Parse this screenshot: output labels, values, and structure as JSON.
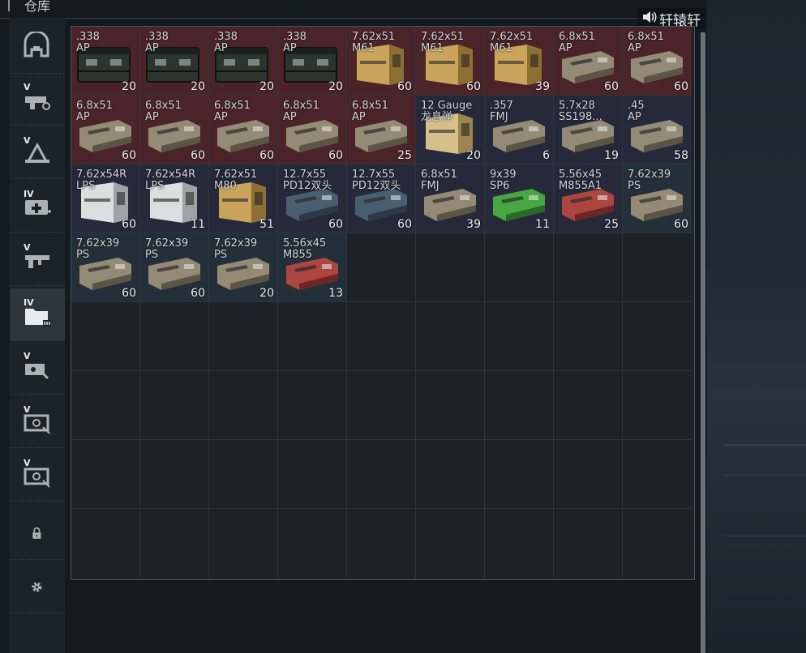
{
  "header": {
    "title": "仓库"
  },
  "sound": {
    "icon": "speaker-icon",
    "label": "轩辕轩"
  },
  "sidebar": {
    "items": [
      {
        "name": "vault-icon",
        "tier": ""
      },
      {
        "name": "tier5-weapon-icon",
        "tier": "V"
      },
      {
        "name": "tier5-armor-icon",
        "tier": "V"
      },
      {
        "name": "tier4-medical-icon",
        "tier": "IV"
      },
      {
        "name": "tier5-gun-icon",
        "tier": "V"
      },
      {
        "name": "tier4-folder-icon",
        "tier": "IV"
      },
      {
        "name": "tier5-gear-icon",
        "tier": "V"
      },
      {
        "name": "tier5-case-icon",
        "tier": "V"
      },
      {
        "name": "tier5-case2-icon",
        "tier": "V"
      },
      {
        "name": "lock-icon",
        "tier": ""
      },
      {
        "name": "gear-icon",
        "tier": ""
      }
    ]
  },
  "colors": {
    "red_cell": "#4b2429",
    "blue_cell": "#25293a",
    "steel_cell": "#233039",
    "box_green": "#2c3430",
    "box_tan": "#bf9a52",
    "box_white": "#d9dcdd",
    "box_steel": "#42566a",
    "box_khaki": "#8c826e",
    "box_green_bright": "#3f9c3b",
    "box_red": "#a7403c"
  },
  "items": [
    {
      "caliber": ".338",
      "type": "AP",
      "qty": "20",
      "bg": "red",
      "box": "crate"
    },
    {
      "caliber": ".338",
      "type": "AP",
      "qty": "20",
      "bg": "red",
      "box": "crate"
    },
    {
      "caliber": ".338",
      "type": "AP",
      "qty": "20",
      "bg": "red",
      "box": "crate"
    },
    {
      "caliber": ".338",
      "type": "AP",
      "qty": "20",
      "bg": "red",
      "box": "crate"
    },
    {
      "caliber": "7.62x51",
      "type": "M61",
      "qty": "60",
      "bg": "red",
      "box": "tan"
    },
    {
      "caliber": "7.62x51",
      "type": "M61",
      "qty": "60",
      "bg": "red",
      "box": "tan"
    },
    {
      "caliber": "7.62x51",
      "type": "M61",
      "qty": "39",
      "bg": "red",
      "box": "tan"
    },
    {
      "caliber": "6.8x51",
      "type": "AP",
      "qty": "60",
      "bg": "red",
      "box": "khaki"
    },
    {
      "caliber": "6.8x51",
      "type": "AP",
      "qty": "60",
      "bg": "red",
      "box": "khaki"
    },
    {
      "caliber": "6.8x51",
      "type": "AP",
      "qty": "60",
      "bg": "red",
      "box": "khaki"
    },
    {
      "caliber": "6.8x51",
      "type": "AP",
      "qty": "60",
      "bg": "red",
      "box": "khaki"
    },
    {
      "caliber": "6.8x51",
      "type": "AP",
      "qty": "60",
      "bg": "red",
      "box": "khaki"
    },
    {
      "caliber": "6.8x51",
      "type": "AP",
      "qty": "60",
      "bg": "red",
      "box": "khaki"
    },
    {
      "caliber": "6.8x51",
      "type": "AP",
      "qty": "25",
      "bg": "red",
      "box": "khaki"
    },
    {
      "caliber": "12 Gauge",
      "type": "龙息弹",
      "qty": "20",
      "bg": "blue",
      "box": "tan-tall"
    },
    {
      "caliber": ".357",
      "type": "FMJ",
      "qty": "6",
      "bg": "blue",
      "box": "khaki"
    },
    {
      "caliber": "5.7x28",
      "type": "SS198...",
      "qty": "19",
      "bg": "blue",
      "box": "khaki"
    },
    {
      "caliber": ".45",
      "type": "AP",
      "qty": "58",
      "bg": "blue",
      "box": "khaki"
    },
    {
      "caliber": "7.62x54R",
      "type": "LPS",
      "qty": "60",
      "bg": "blue",
      "box": "white"
    },
    {
      "caliber": "7.62x54R",
      "type": "LPS",
      "qty": "11",
      "bg": "blue",
      "box": "white"
    },
    {
      "caliber": "7.62x51",
      "type": "M80",
      "qty": "51",
      "bg": "blue",
      "box": "tan"
    },
    {
      "caliber": "12.7x55",
      "type": "PD12双头",
      "qty": "60",
      "bg": "blue",
      "box": "steel"
    },
    {
      "caliber": "12.7x55",
      "type": "PD12双头",
      "qty": "60",
      "bg": "blue",
      "box": "steel"
    },
    {
      "caliber": "6.8x51",
      "type": "FMJ",
      "qty": "39",
      "bg": "blue",
      "box": "khaki"
    },
    {
      "caliber": "9x39",
      "type": "SP6",
      "qty": "11",
      "bg": "blue",
      "box": "green"
    },
    {
      "caliber": "5.56x45",
      "type": "M855A1",
      "qty": "25",
      "bg": "blue",
      "box": "red"
    },
    {
      "caliber": "7.62x39",
      "type": "PS",
      "qty": "60",
      "bg": "steel",
      "box": "khaki"
    },
    {
      "caliber": "7.62x39",
      "type": "PS",
      "qty": "60",
      "bg": "steel",
      "box": "khaki"
    },
    {
      "caliber": "7.62x39",
      "type": "PS",
      "qty": "60",
      "bg": "steel",
      "box": "khaki"
    },
    {
      "caliber": "7.62x39",
      "type": "PS",
      "qty": "20",
      "bg": "steel",
      "box": "khaki"
    },
    {
      "caliber": "5.56x45",
      "type": "M855",
      "qty": "13",
      "bg": "steel",
      "box": "red"
    }
  ],
  "grid": {
    "columns": 9,
    "rows": 8
  }
}
